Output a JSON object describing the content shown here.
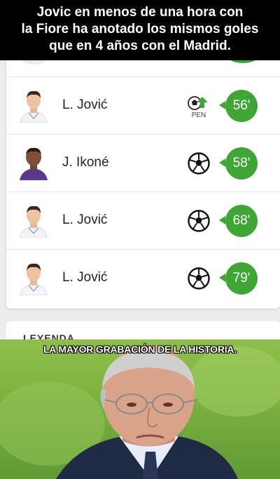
{
  "caption": {
    "line1": "Jovic en menos de una hora con",
    "line2": "la Fiore ha anotado los mismos goles",
    "line3": "que en 4 años con el Madrid."
  },
  "events": [
    {
      "player": "L. Jović",
      "minute": "56'",
      "event_icon": "penalty-goal-icon",
      "event_label": "PEN"
    },
    {
      "player": "J. Ikoné",
      "minute": "58'",
      "event_icon": "soccer-ball-icon"
    },
    {
      "player": "L. Jović",
      "minute": "68'",
      "event_icon": "soccer-ball-icon"
    },
    {
      "player": "L. Jović",
      "minute": "79'",
      "event_icon": "soccer-ball-icon"
    }
  ],
  "legend": {
    "title": "LEYENDA"
  },
  "meme": {
    "text": "LA MAYOR GRABACIÓN DE LA HISTORIA."
  },
  "colors": {
    "accent": "#3fa535",
    "caption_bg": "#000000",
    "pitch": "#7eb23f"
  }
}
